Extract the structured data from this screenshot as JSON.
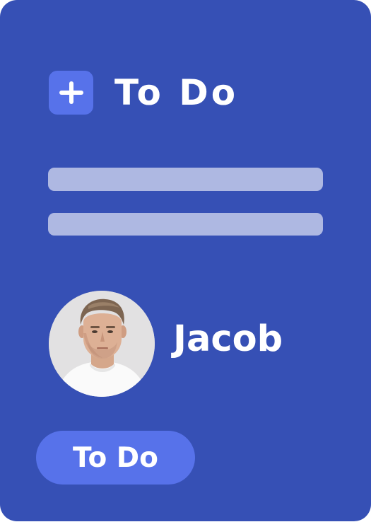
{
  "header": {
    "title": "To Do",
    "add_icon": "plus-icon"
  },
  "user": {
    "name": "Jacob",
    "avatar": "avatar-photo"
  },
  "button": {
    "label": "To Do"
  },
  "colors": {
    "card_background": "#3650b5",
    "accent": "#5772ea",
    "placeholder_bar": "#aeb8e2",
    "text": "#ffffff"
  }
}
